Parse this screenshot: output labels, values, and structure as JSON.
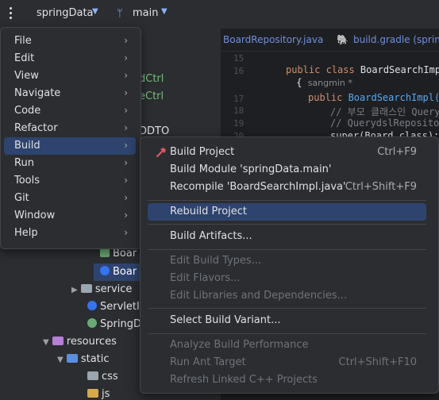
{
  "titlebar": {
    "project": "springData",
    "branch": "main"
  },
  "editor": {
    "tabs": [
      "BoardRepository.java",
      "build.gradle (springD"
    ],
    "line_numbers": [
      "15",
      "16",
      "17",
      "18",
      "19",
      "20"
    ],
    "code": {
      "l16_kw": "public class ",
      "l16_cls": "BoardSearchImpl",
      "l16b": " {",
      "author_hint": "sangmin *",
      "l17_kw": "public ",
      "l17_fn": "BoardSearchImpl()",
      "l18_cm": "// 부모 클래스인 Query",
      "l19_cm": "// QuerydslRepositor",
      "l20": "super(Board.class);"
    }
  },
  "tree": {
    "items": {
      "dctrl": "dCtrl",
      "ectrl": "eCtrl",
      "ddto": "DDTO",
      "boarda": "Boar",
      "boardb": "Boar",
      "service": "service",
      "servleti": "ServletI",
      "springd": "SpringD",
      "resources": "resources",
      "static": "static",
      "css": "css",
      "js": "js"
    }
  },
  "main_menu": {
    "items": [
      {
        "label": "File"
      },
      {
        "label": "Edit"
      },
      {
        "label": "View"
      },
      {
        "label": "Navigate"
      },
      {
        "label": "Code"
      },
      {
        "label": "Refactor"
      },
      {
        "label": "Build"
      },
      {
        "label": "Run"
      },
      {
        "label": "Tools"
      },
      {
        "label": "Git"
      },
      {
        "label": "Window"
      },
      {
        "label": "Help"
      }
    ],
    "active": "Build"
  },
  "build_menu": {
    "items": [
      {
        "label": "Build Project",
        "shortcut": "Ctrl+F9"
      },
      {
        "label": "Build Module 'springData.main'",
        "shortcut": ""
      },
      {
        "label": "Recompile 'BoardSearchImpl.java'",
        "shortcut": "Ctrl+Shift+F9"
      },
      {
        "label": "Rebuild Project",
        "shortcut": ""
      },
      {
        "label": "Build Artifacts...",
        "shortcut": ""
      },
      {
        "label": "Edit Build Types...",
        "shortcut": ""
      },
      {
        "label": "Edit Flavors...",
        "shortcut": ""
      },
      {
        "label": "Edit Libraries and Dependencies...",
        "shortcut": ""
      },
      {
        "label": "Select Build Variant...",
        "shortcut": ""
      },
      {
        "label": "Analyze Build Performance",
        "shortcut": ""
      },
      {
        "label": "Run Ant Target",
        "shortcut": "Ctrl+Shift+F10"
      },
      {
        "label": "Refresh Linked C++ Projects",
        "shortcut": ""
      }
    ],
    "highlighted": "Rebuild Project"
  },
  "colors": {
    "accent": "#2e436e",
    "menu_bg": "#2b2d30",
    "hammer": "#e05561"
  }
}
